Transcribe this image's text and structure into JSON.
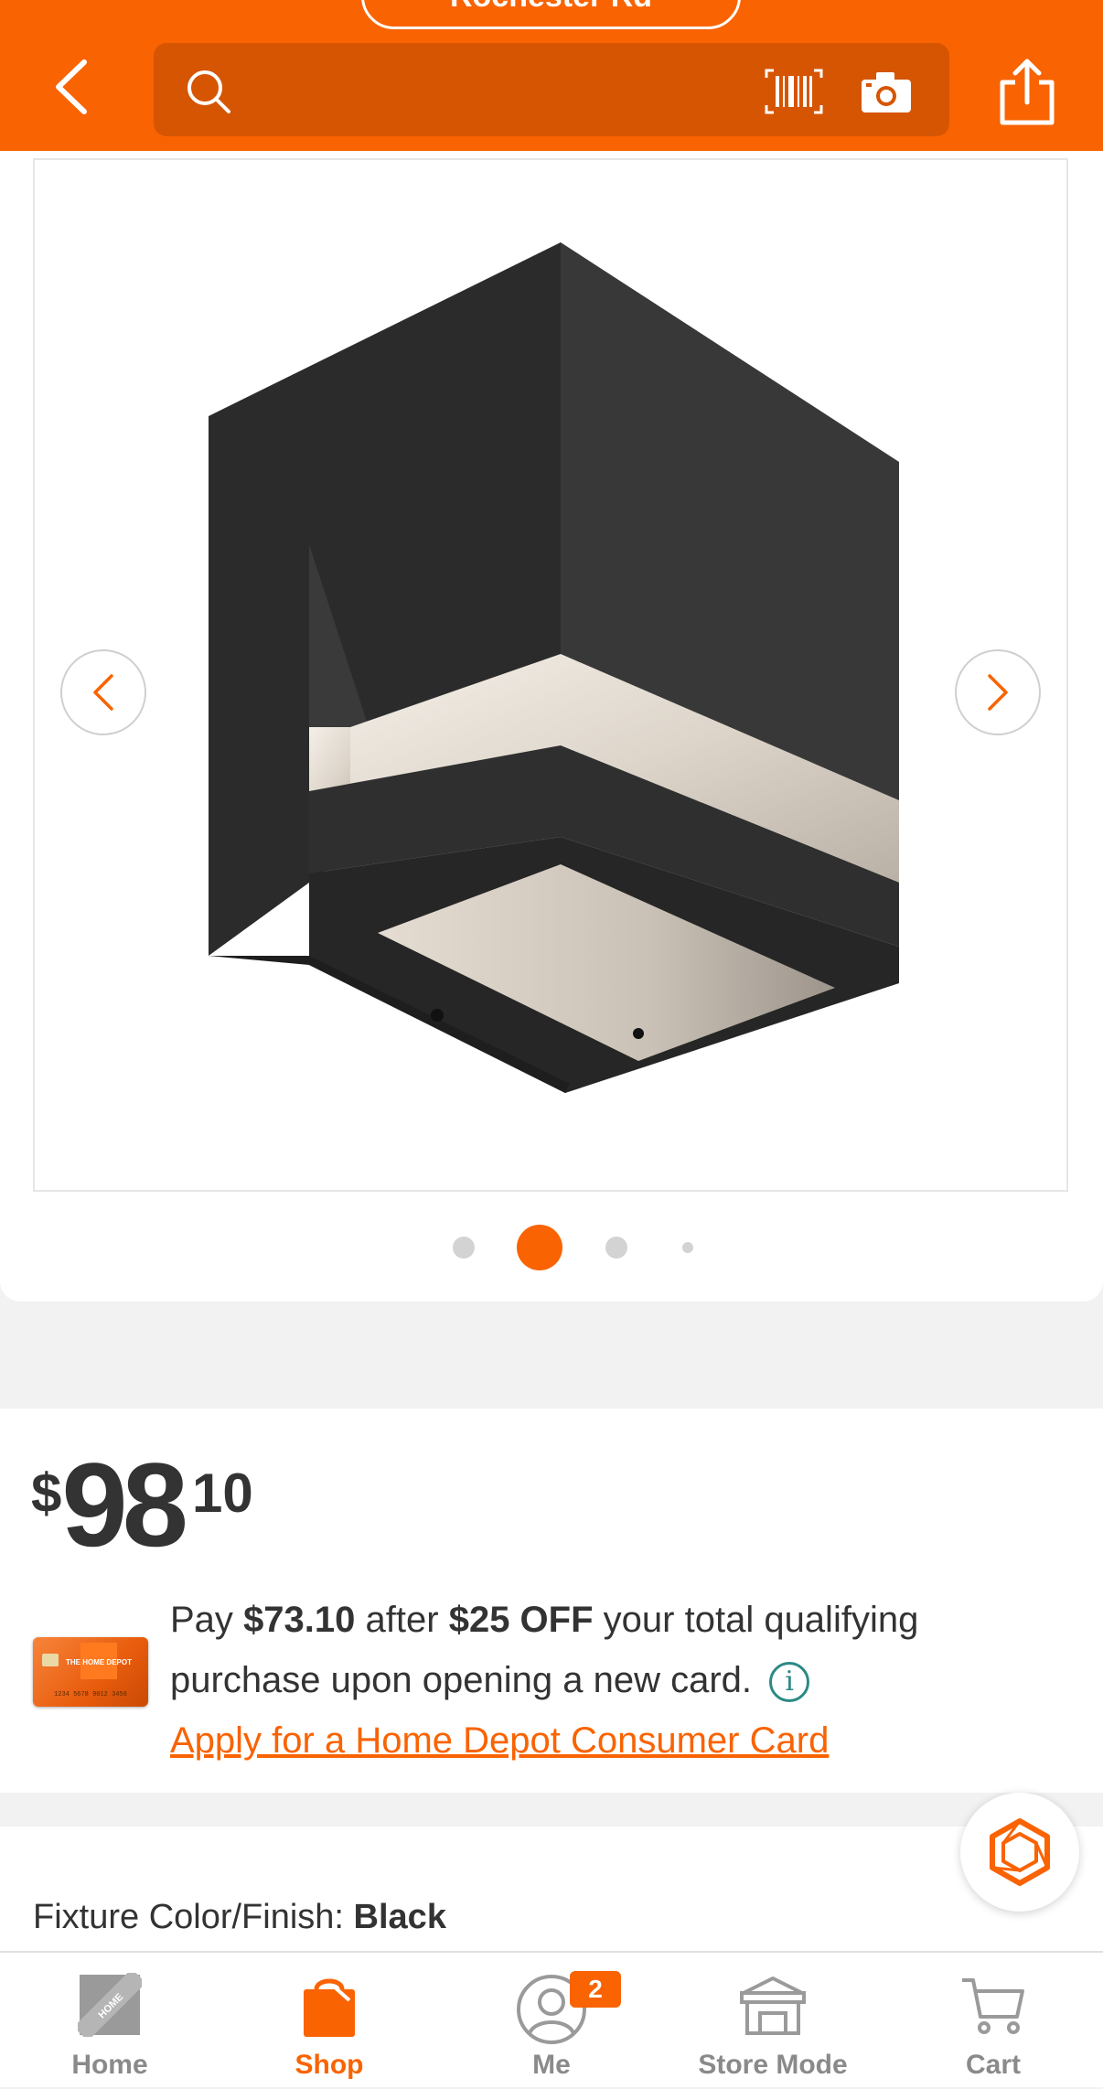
{
  "header": {
    "store_label": "Rochester Rd",
    "search_placeholder": "",
    "icons": [
      "back-icon",
      "search-icon",
      "barcode-icon",
      "camera-icon",
      "share-icon"
    ],
    "brand_color": "#f96302"
  },
  "gallery": {
    "image_alt": "Black square LED outdoor wall light",
    "dots_total": 4,
    "active_dot": 2
  },
  "price": {
    "dollar": "$",
    "main": "98",
    "cents": "10"
  },
  "offer": {
    "pay": "Pay",
    "pay_amount": "$73.10",
    "after": "after",
    "off_amount": "$25 OFF",
    "rest_line1": "your total qualifying purchase upon opening a new card.",
    "info_symbol": "i",
    "apply_link": "Apply for a Home Depot Consumer Card",
    "card_brand": "THE HOME DEPOT",
    "card_number": "1234 5678 9012 3456"
  },
  "specs": {
    "color_label": "Fixture Color/Finish:",
    "color_value": "Black"
  },
  "tabbar": {
    "tabs": [
      {
        "label": "Home",
        "icon": "home-depot-logo-icon"
      },
      {
        "label": "Shop",
        "icon": "shop-icon",
        "active": true
      },
      {
        "label": "Me",
        "icon": "user-icon",
        "badge": "2"
      },
      {
        "label": "Store Mode",
        "icon": "store-icon"
      },
      {
        "label": "Cart",
        "icon": "cart-icon"
      }
    ]
  }
}
